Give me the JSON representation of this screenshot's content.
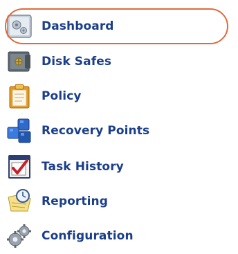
{
  "nav": {
    "items": [
      {
        "label": "Dashboard",
        "icon": "dashboard-icon"
      },
      {
        "label": "Disk Safes",
        "icon": "disk-safe-icon"
      },
      {
        "label": "Policy",
        "icon": "clipboard-icon"
      },
      {
        "label": "Recovery Points",
        "icon": "cubes-icon"
      },
      {
        "label": "Task History",
        "icon": "checklist-icon"
      },
      {
        "label": "Reporting",
        "icon": "clock-report-icon"
      },
      {
        "label": "Configuration",
        "icon": "gears-icon"
      }
    ],
    "selected": "Dashboard"
  },
  "colors": {
    "label": "#1a3e8a",
    "highlight": "#e06a3c"
  }
}
